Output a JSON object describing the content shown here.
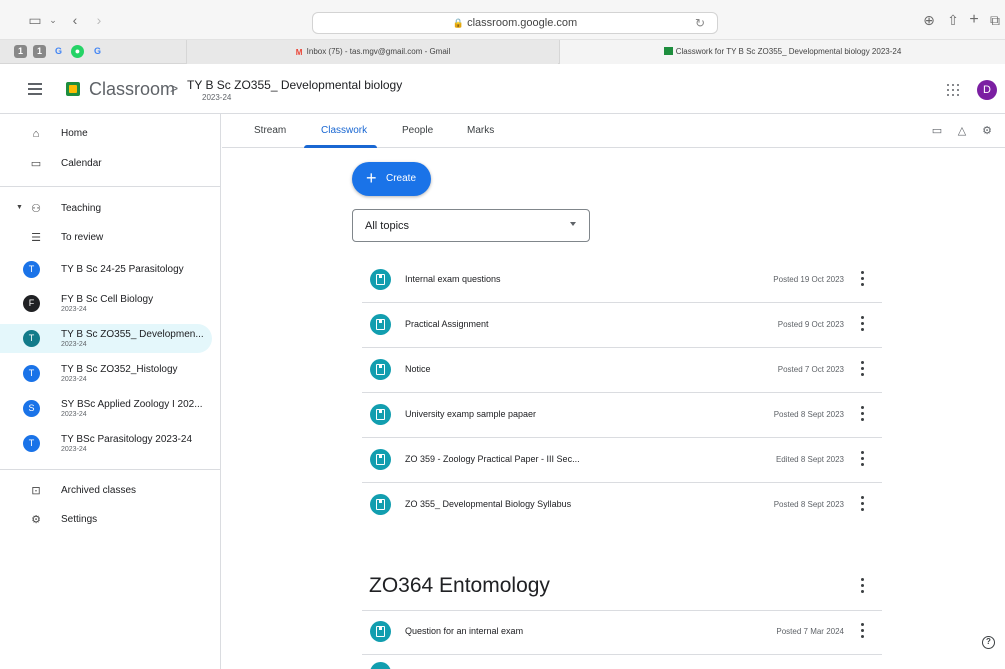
{
  "browser": {
    "url": "classroom.google.com",
    "tabs": [
      {
        "label": "Inbox (75) - tas.mgv@gmail.com - Gmail"
      },
      {
        "label": "Classwork for TY B Sc ZO355_ Developmental biology 2023-24"
      }
    ]
  },
  "header": {
    "app_name": "Classroom",
    "separator": ">",
    "class_title": "TY B Sc ZO355_ Developmental biology",
    "class_year": "2023-24",
    "avatar_letter": "D"
  },
  "sidebar": {
    "home": "Home",
    "calendar": "Calendar",
    "teaching": "Teaching",
    "to_review": "To review",
    "classes": [
      {
        "initial": "T",
        "name": "TY B Sc 24-25 Parasitology",
        "sub": "",
        "color": "#1a73e8"
      },
      {
        "initial": "F",
        "name": "FY B Sc Cell Biology",
        "sub": "2023-24",
        "color": "#202124"
      },
      {
        "initial": "T",
        "name": "TY B Sc ZO355_ Developmen...",
        "sub": "2023-24",
        "color": "#137b8a"
      },
      {
        "initial": "T",
        "name": "TY B Sc ZO352_Histology",
        "sub": "2023-24",
        "color": "#1a73e8"
      },
      {
        "initial": "S",
        "name": "SY BSc Applied Zoology I 202...",
        "sub": "2023-24",
        "color": "#1a73e8"
      },
      {
        "initial": "T",
        "name": "TY BSc Parasitology 2023-24",
        "sub": "2023-24",
        "color": "#1a73e8"
      }
    ],
    "archived": "Archived classes",
    "settings": "Settings"
  },
  "tabs": {
    "stream": "Stream",
    "classwork": "Classwork",
    "people": "People",
    "marks": "Marks"
  },
  "classwork": {
    "create_label": "Create",
    "topic_filter": "All topics",
    "items": [
      {
        "title": "Internal exam questions",
        "date": "Posted 19 Oct 2023"
      },
      {
        "title": "Practical Assignment",
        "date": "Posted 9 Oct 2023"
      },
      {
        "title": "Notice",
        "date": "Posted 7 Oct 2023"
      },
      {
        "title": "University examp sample papaer",
        "date": "Posted 8 Sept 2023"
      },
      {
        "title": "ZO 359 - Zoology Practical Paper - III Sec...",
        "date": "Edited 8 Sept 2023"
      },
      {
        "title": "ZO 355_ Developmental Biology Syllabus",
        "date": "Posted 8 Sept 2023"
      }
    ],
    "section_title": "ZO364 Entomology",
    "section_items": [
      {
        "title": "Question for an internal exam",
        "date": "Posted 7 Mar 2024"
      }
    ]
  },
  "colors": {
    "accent": "#1a73e8",
    "assignment_icon": "#129eaf",
    "selected_bg": "#e4f7fb"
  },
  "icons": [
    "sidebar-toggle-icon",
    "back-icon",
    "forward-icon",
    "lock-icon",
    "reload-icon",
    "download-icon",
    "share-icon",
    "new-tab-icon",
    "tabs-icon",
    "hamburger-icon",
    "classroom-logo-icon",
    "apps-grid-icon",
    "home-icon",
    "calendar-icon",
    "teaching-icon",
    "to-review-icon",
    "archive-icon",
    "settings-icon",
    "calendar-view-icon",
    "drive-icon",
    "class-settings-icon",
    "assignment-icon",
    "more-vert-icon",
    "help-icon"
  ]
}
